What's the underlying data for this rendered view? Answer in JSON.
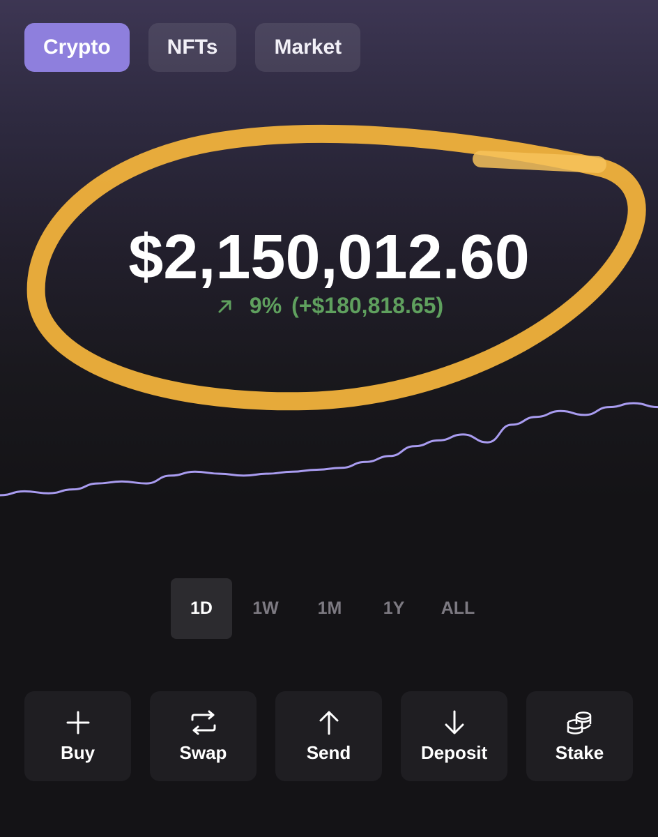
{
  "tabs": [
    {
      "label": "Crypto",
      "active": true
    },
    {
      "label": "NFTs",
      "active": false
    },
    {
      "label": "Market",
      "active": false
    }
  ],
  "balance": {
    "amount": "$2,150,012.60",
    "change_percent": "9%",
    "change_amount": "(+$180,818.65)",
    "change_direction": "up",
    "change_color": "#5fa05e"
  },
  "chart_data": {
    "type": "line",
    "color": "#a99cf0",
    "values": [
      10,
      14,
      12,
      16,
      22,
      24,
      22,
      30,
      34,
      32,
      30,
      32,
      34,
      36,
      38,
      44,
      50,
      60,
      66,
      72,
      64,
      82,
      90,
      96,
      92,
      100,
      104,
      100
    ]
  },
  "ranges": [
    {
      "label": "1D",
      "active": true
    },
    {
      "label": "1W",
      "active": false
    },
    {
      "label": "1M",
      "active": false
    },
    {
      "label": "1Y",
      "active": false
    },
    {
      "label": "ALL",
      "active": false
    }
  ],
  "actions": [
    {
      "label": "Buy",
      "icon": "plus-icon"
    },
    {
      "label": "Swap",
      "icon": "swap-icon"
    },
    {
      "label": "Send",
      "icon": "arrow-up-icon"
    },
    {
      "label": "Deposit",
      "icon": "arrow-down-icon"
    },
    {
      "label": "Stake",
      "icon": "coins-stack-icon"
    }
  ],
  "colors": {
    "accent": "#8e7fdd",
    "highlight": "#f1b23c",
    "positive": "#5fa05e"
  }
}
